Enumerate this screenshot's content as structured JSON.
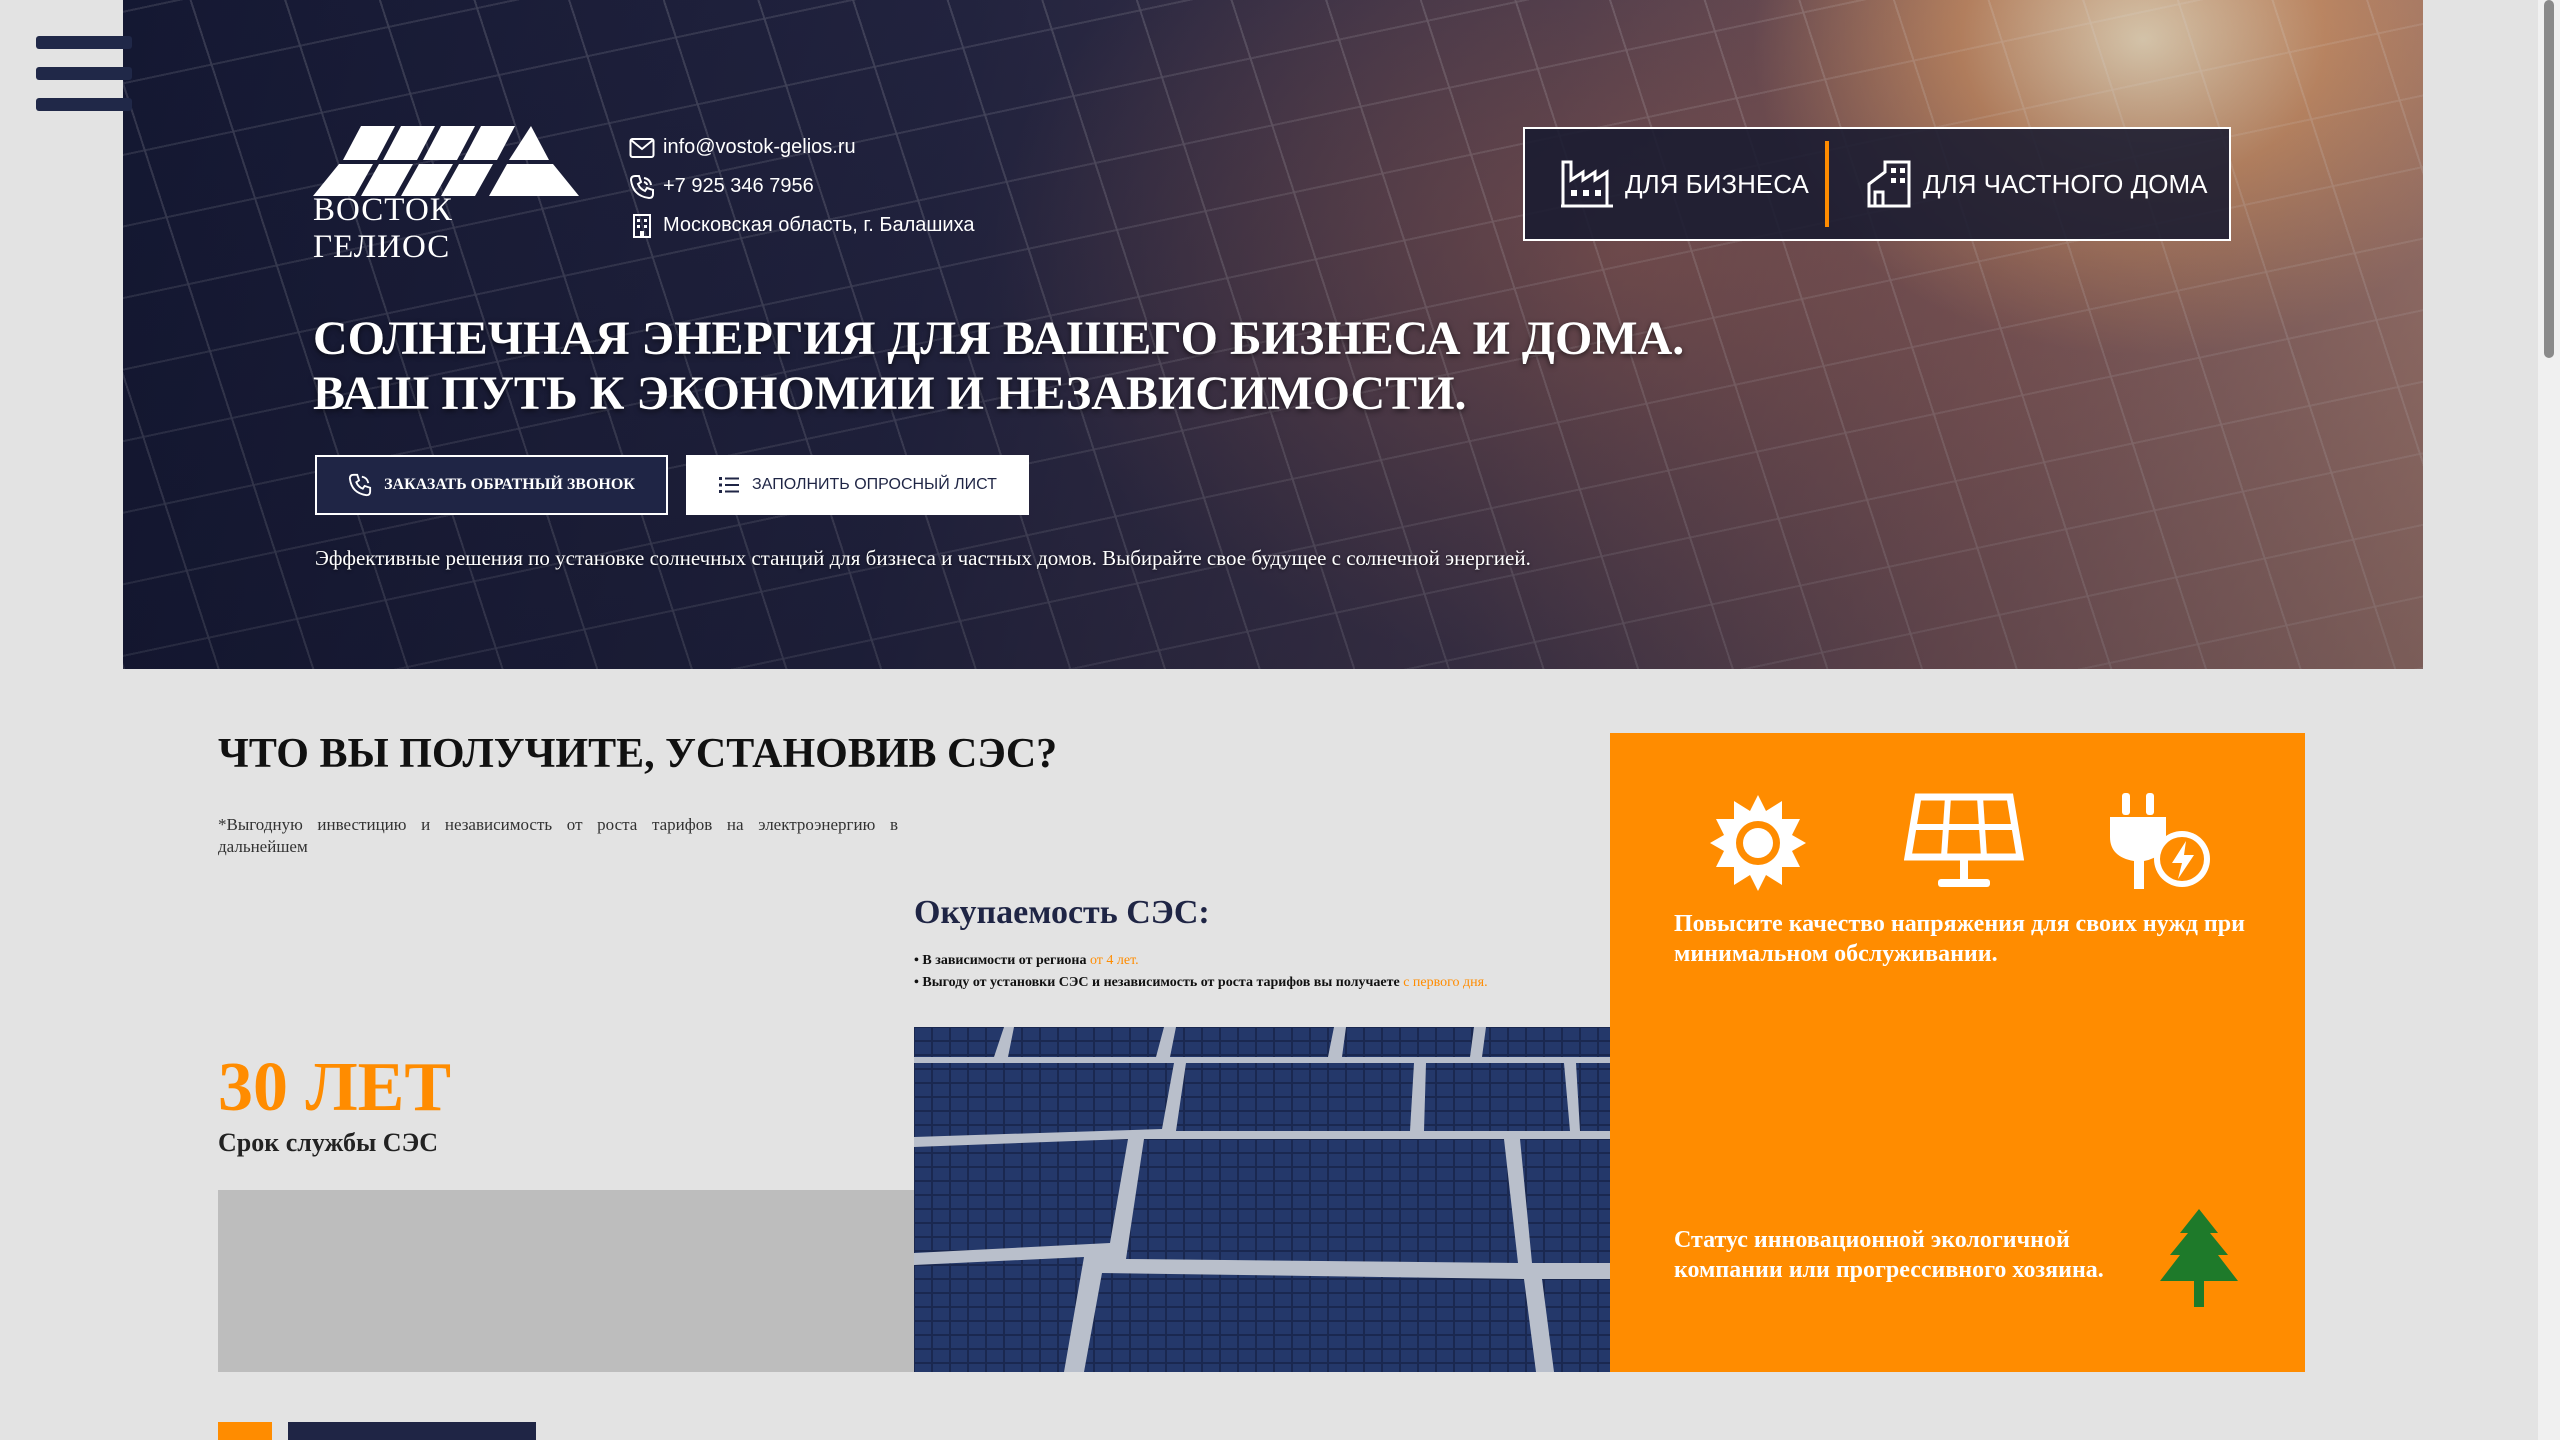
{
  "header": {
    "logo_text": "ВОСТОК ГЕЛИОС",
    "email": "info@vostok-gelios.ru",
    "phone": "+7 925 346 7956",
    "address": "Московская область, г. Балашиха",
    "segments": {
      "business": "ДЛЯ БИЗНЕСА",
      "home": "ДЛЯ ЧАСТНОГО ДОМА"
    }
  },
  "hero": {
    "headline_line1": "СОЛНЕЧНАЯ ЭНЕРГИЯ ДЛЯ ВАШЕГО БИЗНЕСА И ДОМА.",
    "headline_line2": "ВАШ ПУТЬ К ЭКОНОМИИ И НЕЗАВИСИМОСТИ.",
    "callback_button": "ЗАКАЗАТЬ ОБРАТНЫЙ ЗВОНОК",
    "survey_button": "ЗАПОЛНИТЬ ОПРОСНЫЙ ЛИСТ",
    "lead": "Эффективные решения по установке солнечных станций для бизнеса и частных домов. Выбирайте свое будущее с солнечной энергией."
  },
  "benefits": {
    "title": "ЧТО ВЫ ПОЛУЧИТЕ, УСТАНОВИВ СЭС?",
    "note": "*Выгодную инвестицию и независимость от роста тарифов на электроэнергию в дальнейшем",
    "lifetime_value": "30 ЛЕТ",
    "lifetime_label": "Срок службы СЭС",
    "payback_title": "Окупаемость СЭС:",
    "payback_item1_text": "• В зависимости от региона ",
    "payback_item1_hl": "от 4 лет.",
    "payback_item2_text": "• Выгоду от установки СЭС и независимость от роста тарифов вы получаете ",
    "payback_item2_hl": "с первого дня.",
    "orange_text1": "Повысите качество напряжения для своих нужд при минимальном обслуживании.",
    "orange_text2": "Статус инновационной экологичной компании или прогрессивного хозяина."
  },
  "colors": {
    "accent": "#ff8c00",
    "navy": "#1f2545",
    "tree": "#1e7a2a"
  },
  "icons": [
    "menu-icon",
    "mail-icon",
    "phone-icon",
    "building-icon",
    "factory-icon",
    "house-icon",
    "phone-callback-icon",
    "list-icon",
    "sun-icon",
    "solar-panel-icon",
    "plug-icon",
    "tree-icon"
  ]
}
